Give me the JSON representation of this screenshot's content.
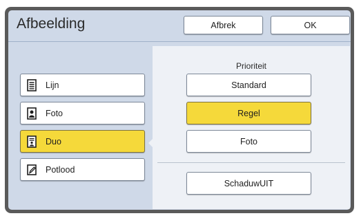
{
  "window": {
    "title": "Afbeelding"
  },
  "header": {
    "cancel_label": "Afbrek",
    "ok_label": "OK"
  },
  "left_modes": [
    {
      "label": "Lijn",
      "icon": "document-lines-icon",
      "active": false
    },
    {
      "label": "Foto",
      "icon": "photo-portrait-icon",
      "active": false
    },
    {
      "label": "Duo",
      "icon": "document-duo-icon",
      "active": true
    },
    {
      "label": "Potlood",
      "icon": "pencil-icon",
      "active": false
    }
  ],
  "priority": {
    "heading": "Prioriteit",
    "options": [
      {
        "label": "Standard",
        "active": false
      },
      {
        "label": "Regel",
        "active": true
      },
      {
        "label": "Foto",
        "active": false
      }
    ]
  },
  "shadow_button": {
    "label": "SchaduwUIT"
  },
  "colors": {
    "selected": "#f5d93a",
    "panel": "#cfd9e8",
    "content": "#eef1f6",
    "frame": "#5a5a5a"
  }
}
